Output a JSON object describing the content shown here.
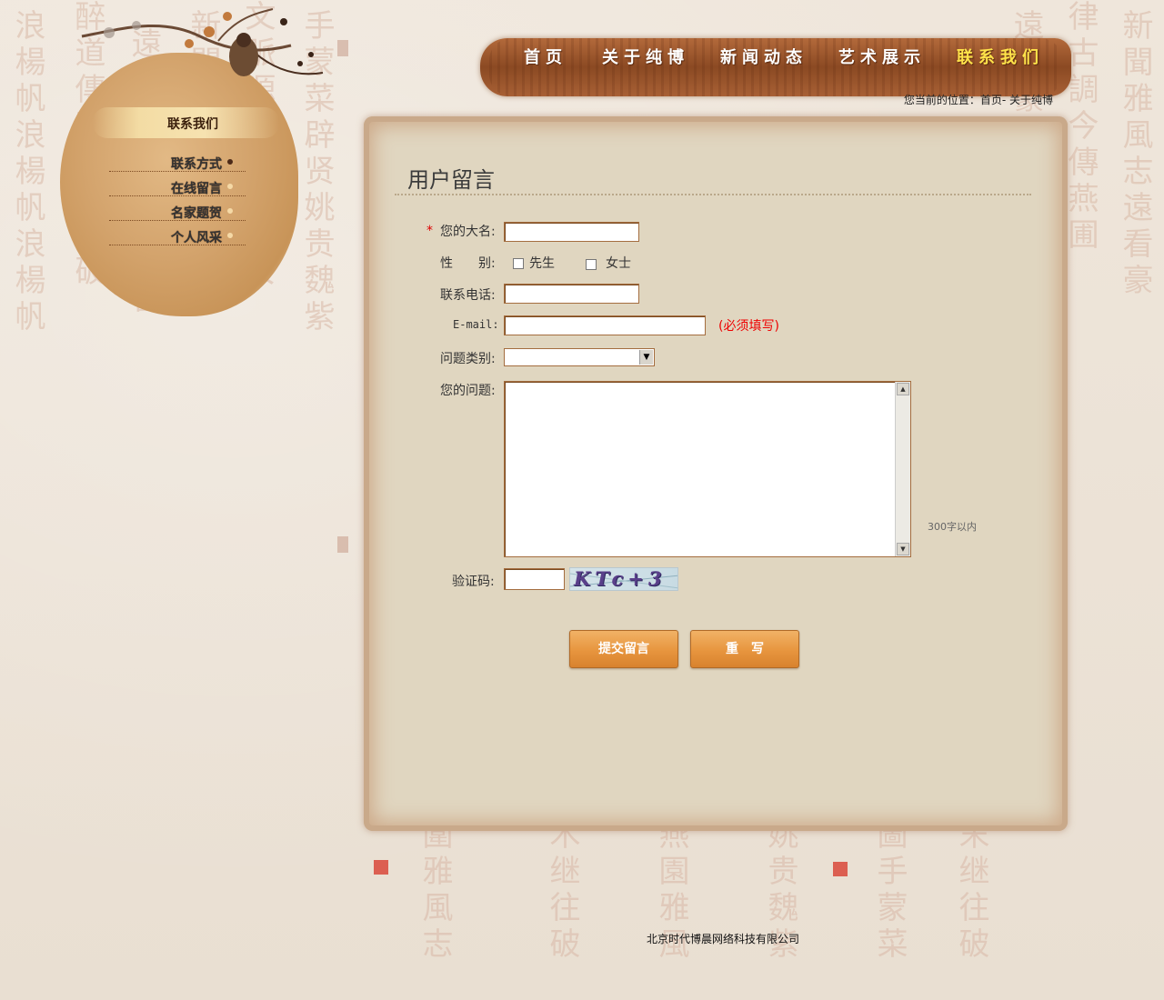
{
  "colors": {
    "nav_bg": "#9b5a2f",
    "nav_active": "#ffe34a",
    "panel_bg": "#e0d6c0",
    "button": "#e7953e",
    "required": "#dd0000"
  },
  "nav": {
    "items": [
      {
        "label": "首页"
      },
      {
        "label": "关于纯博"
      },
      {
        "label": "新闻动态"
      },
      {
        "label": "艺术展示"
      },
      {
        "label": "联系我们"
      }
    ]
  },
  "breadcrumb": "您当前的位置：首页- 关于纯博",
  "sidebar": {
    "title": "联系我们",
    "items": [
      {
        "label": "联系方式"
      },
      {
        "label": "在线留言"
      },
      {
        "label": "名家题贺"
      },
      {
        "label": "个人风采"
      }
    ]
  },
  "form": {
    "title": "用户留言",
    "required_mark": "*",
    "name_label": "您的大名:",
    "gender_label": "性　　别:",
    "gender_options": [
      "先生",
      "女士"
    ],
    "phone_label": "联系电话:",
    "email_label": "E-mail:",
    "email_required_hint": "(必须填写)",
    "category_label": "问题类别:",
    "category_value": "",
    "question_label": "您的问题:",
    "question_limit": "300字以内",
    "captcha_label": "验证码:",
    "captcha_text": "KTc+3",
    "submit_label": "提交留言",
    "reset_label": "重　写"
  },
  "footer": "北京时代博晨网络科技有限公司"
}
